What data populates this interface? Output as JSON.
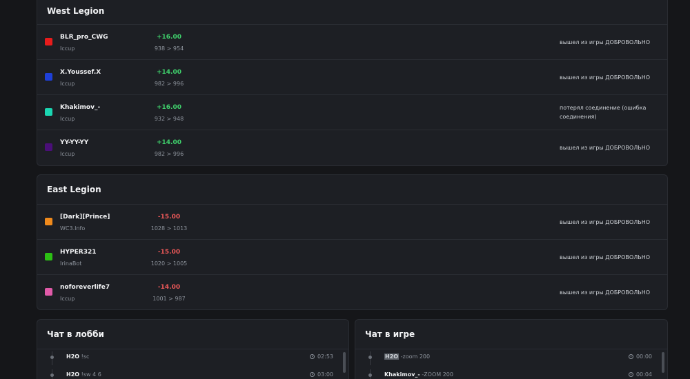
{
  "west": {
    "title": "West Legion",
    "players": [
      {
        "name": "BLR_pro_CWG",
        "source": "Iccup",
        "delta": "+16.00",
        "mmr": "938 > 954",
        "status": "вышел из игры ДОБРОВОЛЬНО",
        "color": "#e81c1c"
      },
      {
        "name": "X.Youssef.X",
        "source": "Iccup",
        "delta": "+14.00",
        "mmr": "982 > 996",
        "status": "вышел из игры ДОБРОВОЛЬНО",
        "color": "#1e40d9"
      },
      {
        "name": "Khakimov_-",
        "source": "Iccup",
        "delta": "+16.00",
        "mmr": "932 > 948",
        "status": "потерял соединение (ошибка соединения)",
        "color": "#1bd6b2"
      },
      {
        "name": "YY-YY-YY",
        "source": "Iccup",
        "delta": "+14.00",
        "mmr": "982 > 996",
        "status": "вышел из игры ДОБРОВОЛЬНО",
        "color": "#4a0f78"
      }
    ]
  },
  "east": {
    "title": "East Legion",
    "players": [
      {
        "name": "[Dark][Prince]",
        "source": "WC3.Info",
        "delta": "-15.00",
        "mmr": "1028 > 1013",
        "status": "вышел из игры ДОБРОВОЛЬНО",
        "color": "#f08a1c"
      },
      {
        "name": "HYPER321",
        "source": "IrinaBot",
        "delta": "-15.00",
        "mmr": "1020 > 1005",
        "status": "вышел из игры ДОБРОВОЛЬНО",
        "color": "#2cbf14"
      },
      {
        "name": "noforeverlife7",
        "source": "Iccup",
        "delta": "-14.00",
        "mmr": "1001 > 987",
        "status": "вышел из игры ДОБРОВОЛЬНО",
        "color": "#e05aa8"
      }
    ]
  },
  "lobby_chat": {
    "title": "Чат в лобби",
    "messages": [
      {
        "author": "H2O",
        "text": "!sc",
        "time": "02:53"
      },
      {
        "author": "H2O",
        "text": "!sw 4 6",
        "time": "03:00"
      }
    ]
  },
  "game_chat": {
    "title": "Чат в игре",
    "messages": [
      {
        "author": "H2O",
        "text": "-zoom 200",
        "time": "00:00"
      },
      {
        "author": "Khakimov_-",
        "text": "-ZOOM 200",
        "time": "00:04"
      }
    ]
  }
}
